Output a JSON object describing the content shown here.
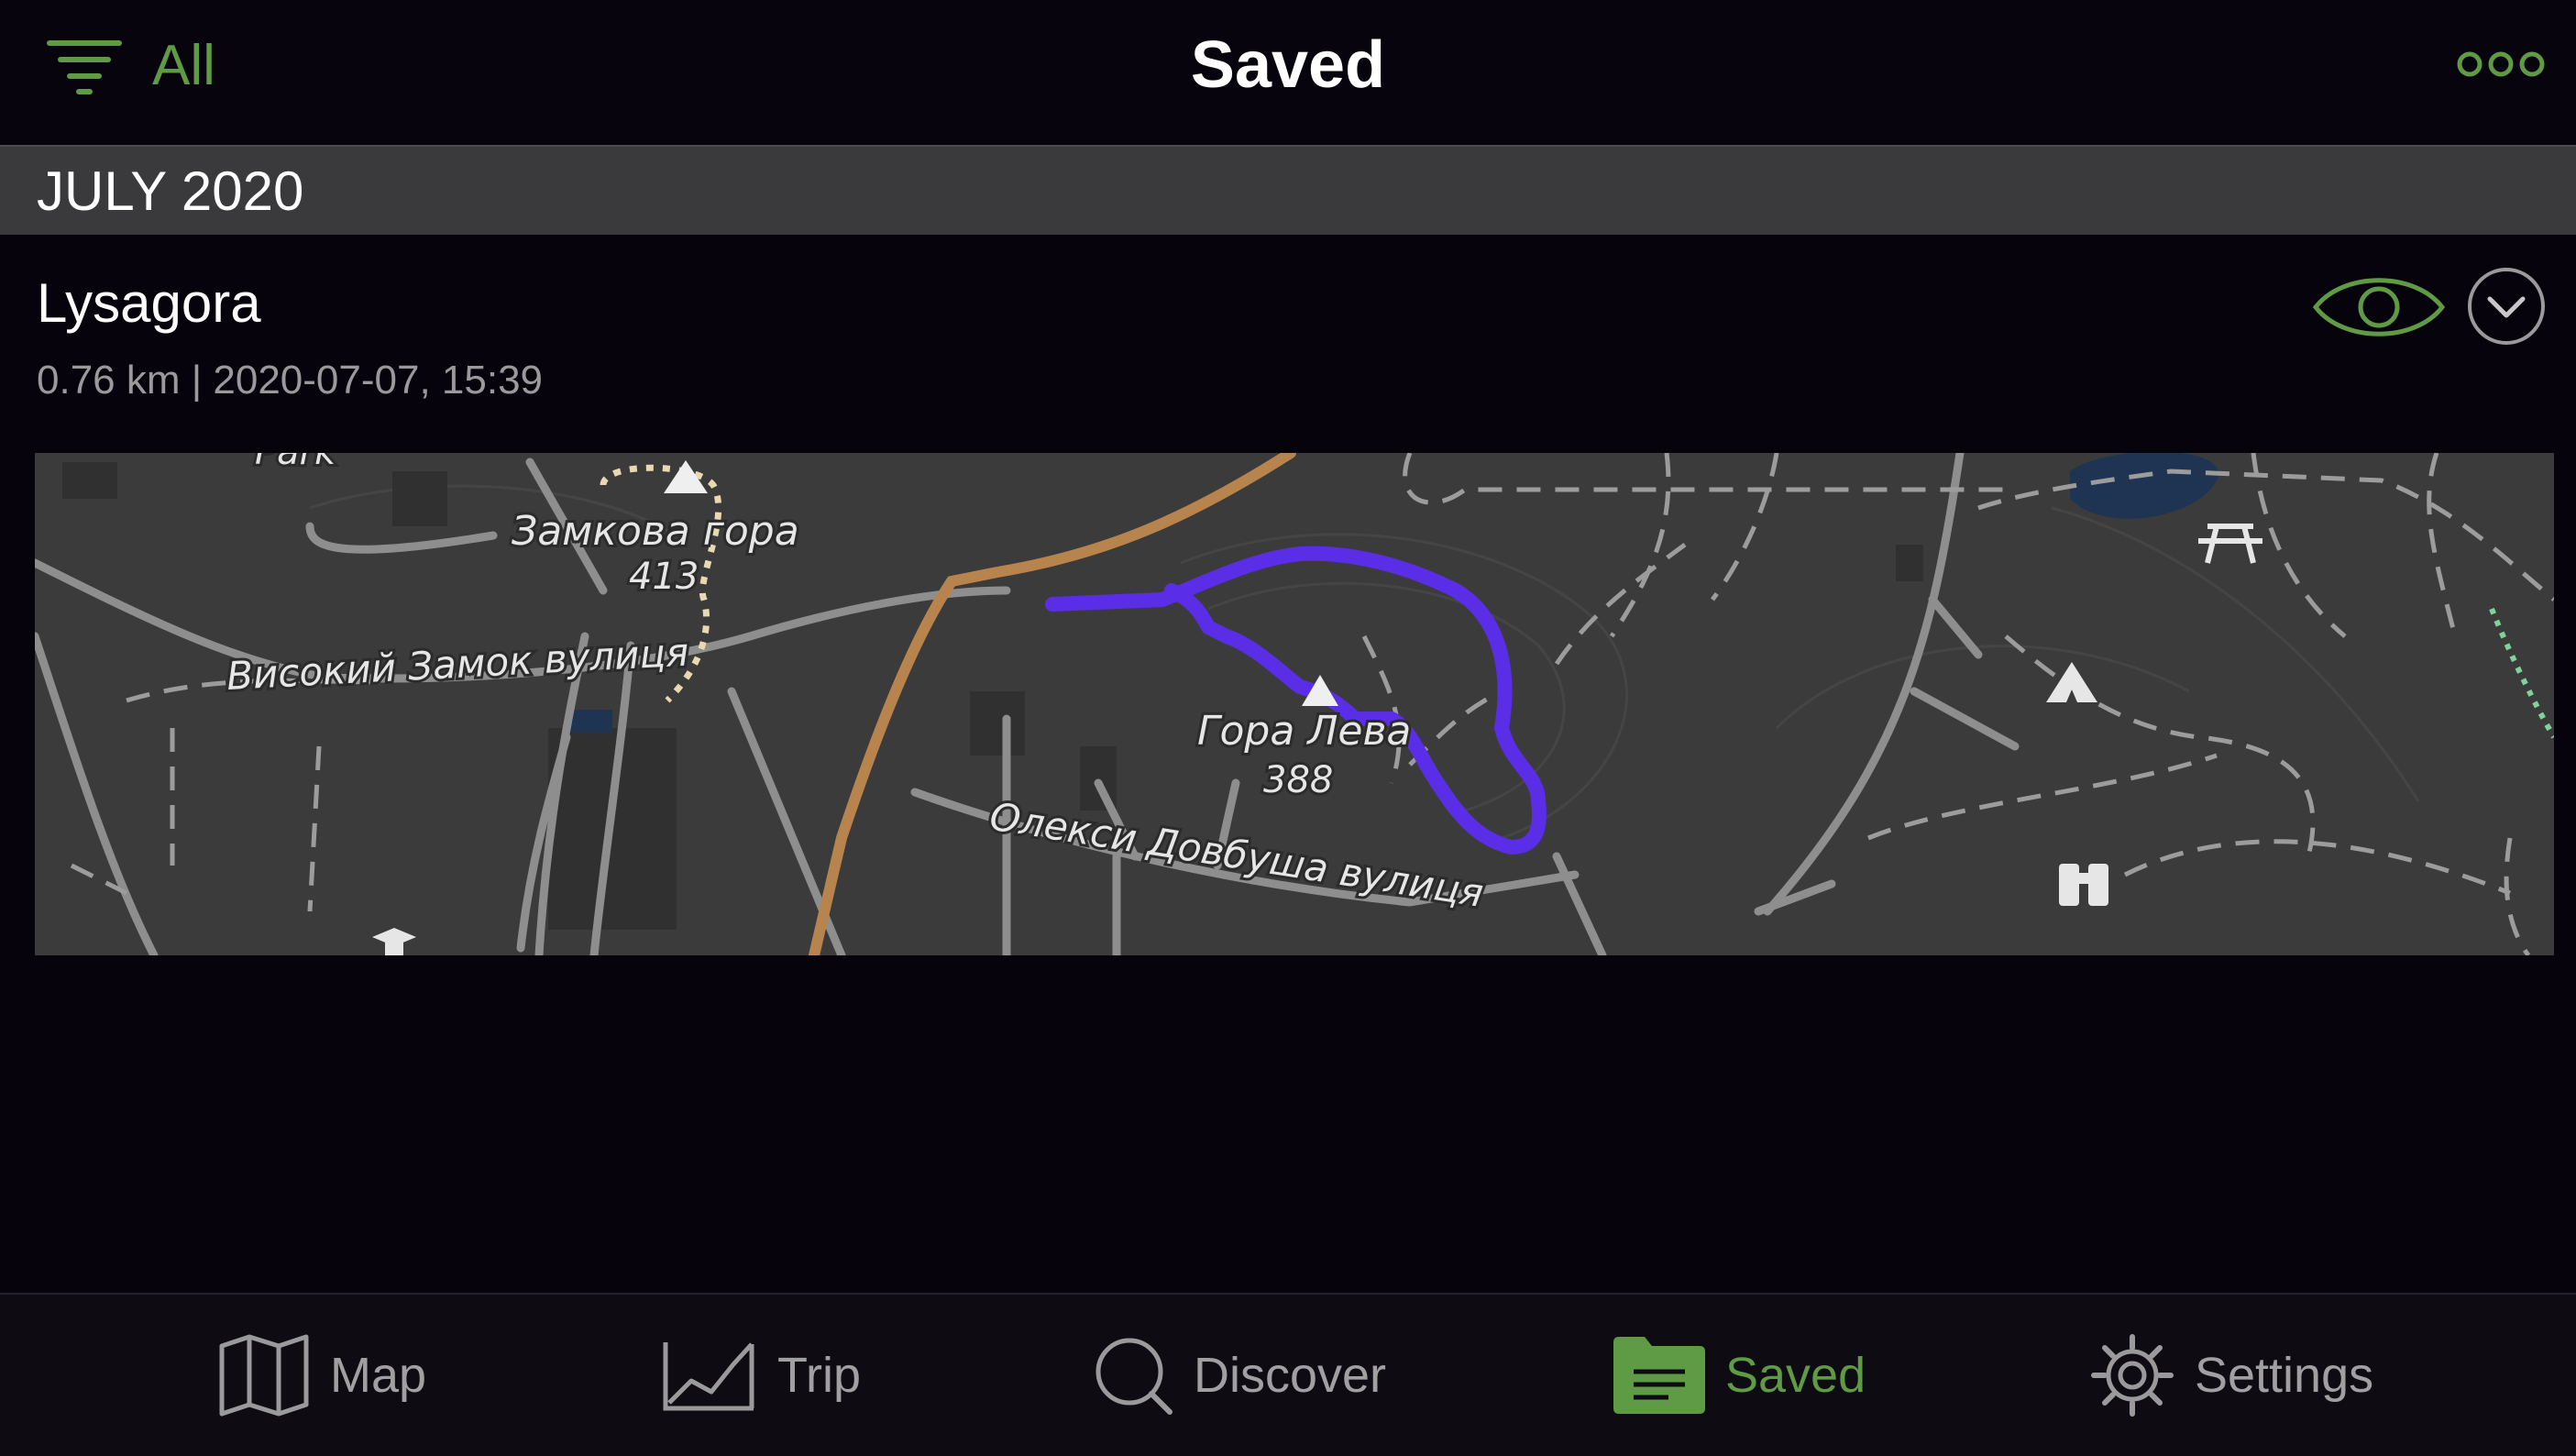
{
  "header": {
    "filter_label": "All",
    "title": "Saved",
    "filter_icon": "filter-lines-icon",
    "more_icon": "more-dots-icon"
  },
  "section": {
    "title": "JULY 2020"
  },
  "entry": {
    "title": "Lysagora",
    "meta": "0.76 km | 2020-07-07, 15:39",
    "visibility_icon": "eye-icon",
    "expand_icon": "chevron-down-icon"
  },
  "map": {
    "labels": {
      "park": "Park",
      "peak1_name": "Замкова гора",
      "peak1_elev": "413",
      "street1": "Високий Замок вулиця",
      "peak2_name": "Гора Лева",
      "peak2_elev": "388",
      "street2": "Олекси Довбуша вулиця"
    },
    "colors": {
      "background": "#3b3b3b",
      "track": "#5a2ee6",
      "main_road": "#b8844e",
      "roads": "#8e8e8e",
      "paths": "#9c9c9c",
      "water": "#1f3452"
    },
    "icons": [
      "peak-icon",
      "picnic-icon",
      "camp-icon",
      "viewpoint-icon",
      "university-icon"
    ]
  },
  "tabbar": {
    "tabs": [
      {
        "label": "Map",
        "icon": "map-icon"
      },
      {
        "label": "Trip",
        "icon": "trip-chart-icon"
      },
      {
        "label": "Discover",
        "icon": "search-icon"
      },
      {
        "label": "Saved",
        "icon": "folder-icon",
        "active": true
      },
      {
        "label": "Settings",
        "icon": "gear-icon"
      }
    ]
  },
  "accent_color": "#5f9a45"
}
